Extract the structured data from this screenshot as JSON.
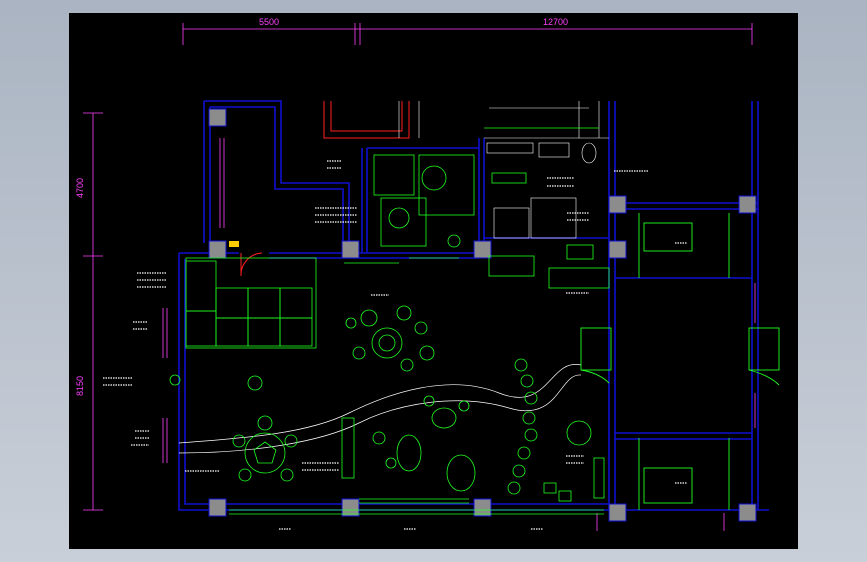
{
  "viewer": {
    "background": "#000000",
    "colors": {
      "wall": "#1010d0",
      "dimension": "#ff40ff",
      "furniture": "#20ff20",
      "line": "#ffffff",
      "door": "#ff2020",
      "column": "#8c8c8c"
    }
  },
  "dimensions": {
    "top_left": "5500",
    "top_right": "12700",
    "left_upper": "4700",
    "left_lower": "8150"
  }
}
